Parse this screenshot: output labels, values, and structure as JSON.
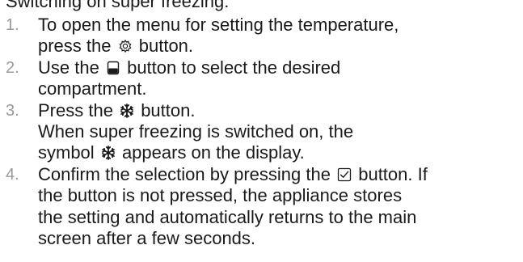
{
  "heading": "Switching on super freezing:",
  "steps": [
    {
      "number": "1.",
      "lines": [
        "To open the menu for setting the temperature,"
      ],
      "pre_icon": "press the",
      "icon": "gear-icon",
      "post_icon": "button."
    },
    {
      "number": "2.",
      "pre_icon": "Use the",
      "icon": "compartment-icon",
      "post_icon": "button to select the desired",
      "lines_after": [
        "compartment."
      ]
    },
    {
      "number": "3.",
      "pre_icon": "Press the",
      "icon": "snowflake-icon",
      "post_icon": "button.",
      "lines_after": [
        "When super freezing is switched on, the"
      ],
      "symbol_pre": "symbol",
      "symbol_icon": "snowflake-icon",
      "symbol_post": "appears on the display."
    },
    {
      "number": "4.",
      "pre_icon": "Confirm the selection by pressing the",
      "icon": "checkbox-icon",
      "post_icon": "button. If",
      "lines_after": [
        "the button is not pressed, the appliance stores",
        "the setting and automatically returns to the main",
        "screen after a few seconds."
      ]
    }
  ]
}
